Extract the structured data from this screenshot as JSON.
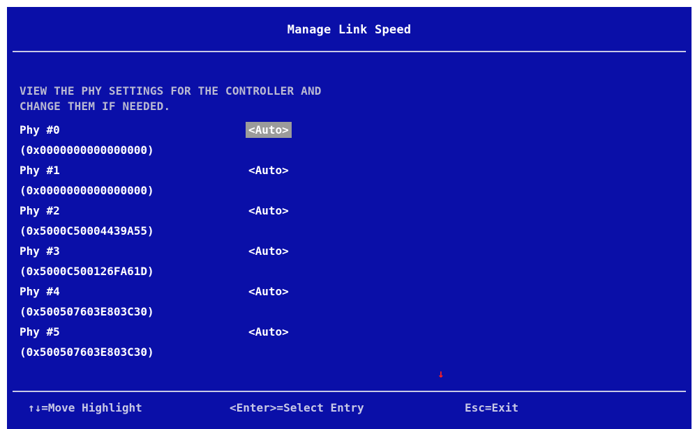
{
  "window": {
    "title": "Manage Link Speed"
  },
  "description": {
    "line1": "VIEW THE PHY SETTINGS FOR THE CONTROLLER AND",
    "line2": "CHANGE THEM IF NEEDED."
  },
  "phys": [
    {
      "label": "Phy #0",
      "address": "(0x0000000000000000)",
      "value": "<Auto>",
      "selected": true
    },
    {
      "label": "Phy #1",
      "address": "(0x0000000000000000)",
      "value": "<Auto>",
      "selected": false
    },
    {
      "label": "Phy #2",
      "address": "(0x5000C50004439A55)",
      "value": "<Auto>",
      "selected": false
    },
    {
      "label": "Phy #3",
      "address": "(0x5000C500126FA61D)",
      "value": "<Auto>",
      "selected": false
    },
    {
      "label": "Phy #4",
      "address": "(0x500507603E803C30)",
      "value": "<Auto>",
      "selected": false
    },
    {
      "label": "Phy #5",
      "address": "(0x500507603E803C30)",
      "value": "<Auto>",
      "selected": false
    }
  ],
  "scroll_indicator": "↓",
  "footer": {
    "move": "↑↓=Move Highlight",
    "select": "<Enter>=Select Entry",
    "exit": "Esc=Exit"
  },
  "colors": {
    "background": "#0a0fa8",
    "highlight": "#9b9b9b",
    "scroll_arrow": "#ff2020"
  }
}
